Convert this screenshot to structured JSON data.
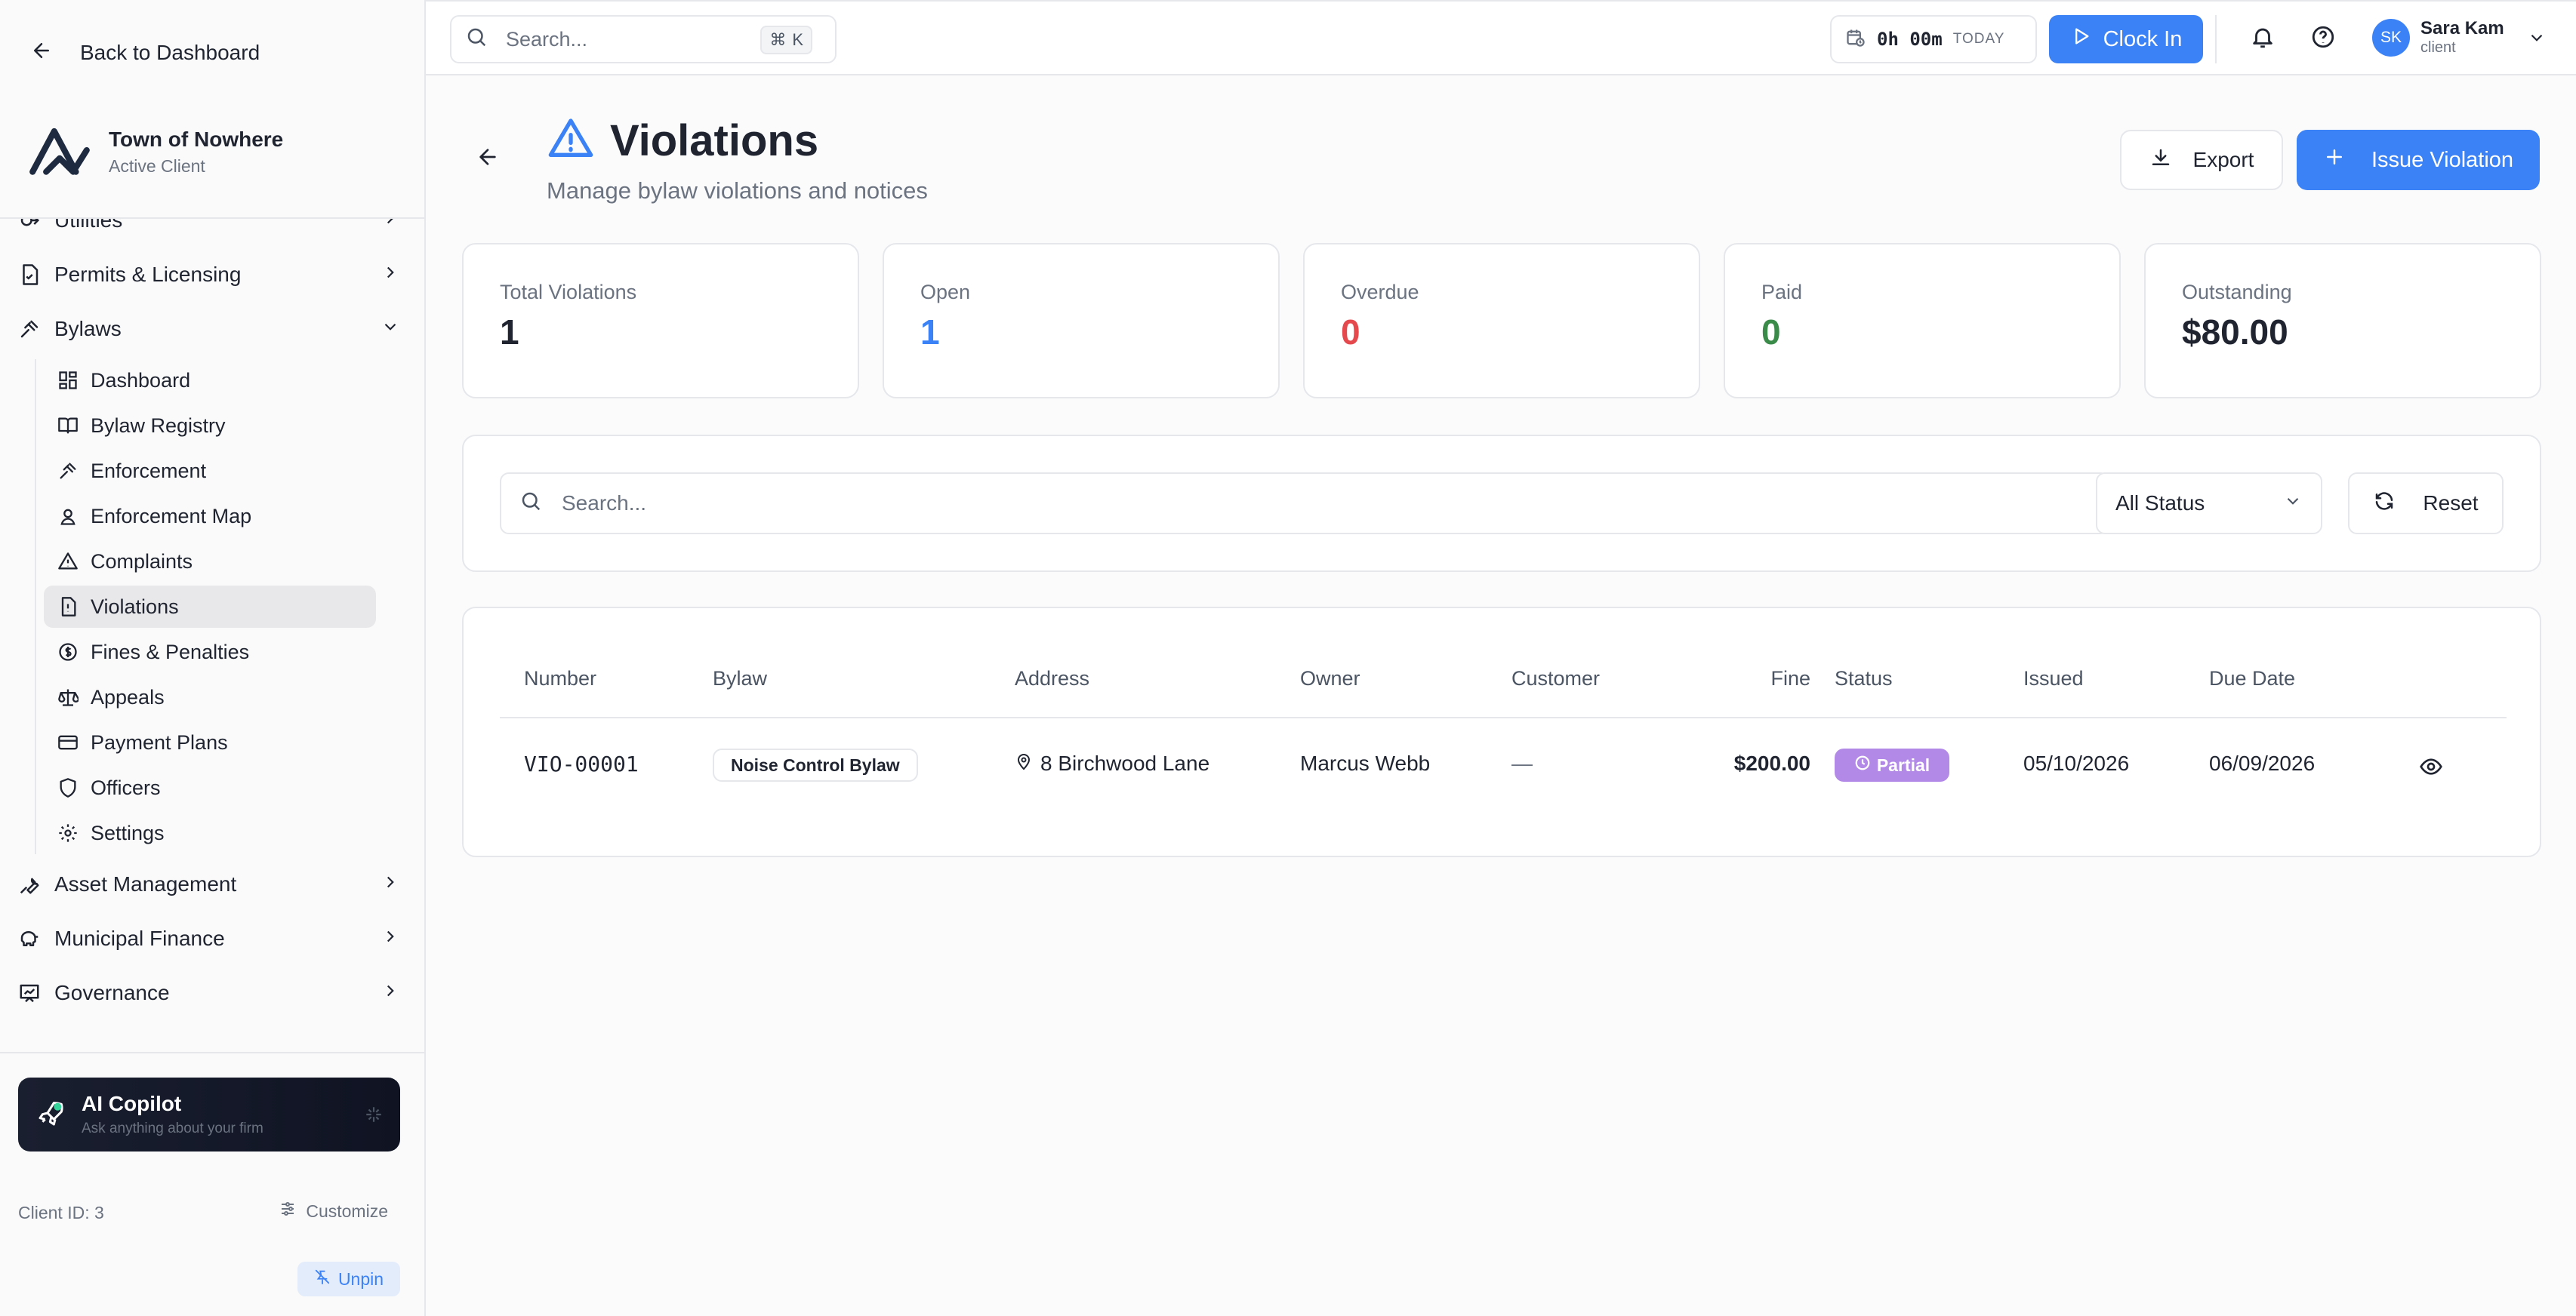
{
  "sidebar": {
    "back_label": "Back to Dashboard",
    "client_name": "Town of Nowhere",
    "client_status": "Active Client",
    "nav": [
      {
        "label": "Utilities",
        "icon": "utilities-icon"
      },
      {
        "label": "Permits & Licensing",
        "icon": "file-check-icon"
      },
      {
        "label": "Bylaws",
        "icon": "gavel-icon",
        "expanded": true
      }
    ],
    "bylaw_items": [
      {
        "label": "Dashboard",
        "icon": "dashboard-icon"
      },
      {
        "label": "Bylaw Registry",
        "icon": "book-icon"
      },
      {
        "label": "Enforcement",
        "icon": "gavel-icon"
      },
      {
        "label": "Enforcement Map",
        "icon": "map-pin-user-icon"
      },
      {
        "label": "Complaints",
        "icon": "warning-icon"
      },
      {
        "label": "Violations",
        "icon": "file-alert-icon",
        "active": true
      },
      {
        "label": "Fines & Penalties",
        "icon": "dollar-circle-icon"
      },
      {
        "label": "Appeals",
        "icon": "scale-icon"
      },
      {
        "label": "Payment Plans",
        "icon": "credit-card-icon"
      },
      {
        "label": "Officers",
        "icon": "shield-icon"
      },
      {
        "label": "Settings",
        "icon": "gear-icon"
      }
    ],
    "nav_bottom": [
      {
        "label": "Asset Management",
        "icon": "wrench-icon"
      },
      {
        "label": "Municipal Finance",
        "icon": "piggy-bank-icon"
      },
      {
        "label": "Governance",
        "icon": "chart-board-icon"
      }
    ],
    "copilot_title": "AI Copilot",
    "copilot_subtitle": "Ask anything about your firm",
    "client_id": "Client ID: 3",
    "customize_label": "Customize",
    "unpin_label": "Unpin"
  },
  "topbar": {
    "search_placeholder": "Search...",
    "shortcut_cmd": "⌘",
    "shortcut_key": "K",
    "timer_value": "0h 00m",
    "timer_label": "TODAY",
    "clock_in_label": "Clock In",
    "user_initials": "SK",
    "user_name": "Sara Kam",
    "user_role": "client"
  },
  "page": {
    "title": "Violations",
    "subtitle": "Manage bylaw violations and notices",
    "export_label": "Export",
    "issue_label": "Issue Violation"
  },
  "stats": [
    {
      "label": "Total Violations",
      "value": "1"
    },
    {
      "label": "Open",
      "value": "1"
    },
    {
      "label": "Overdue",
      "value": "0"
    },
    {
      "label": "Paid",
      "value": "0"
    },
    {
      "label": "Outstanding",
      "value": "$80.00"
    }
  ],
  "filters": {
    "search_placeholder": "Search...",
    "status_selected": "All Status",
    "reset_label": "Reset"
  },
  "table": {
    "columns": [
      "Number",
      "Bylaw",
      "Address",
      "Owner",
      "Customer",
      "Fine",
      "Status",
      "Issued",
      "Due Date"
    ],
    "rows": [
      {
        "number": "VIO-00001",
        "bylaw": "Noise Control Bylaw",
        "address": "8 Birchwood Lane",
        "owner": "Marcus Webb",
        "customer": "—",
        "fine": "$200.00",
        "status": "Partial",
        "issued": "05/10/2026",
        "due_date": "06/09/2026"
      }
    ]
  },
  "colors": {
    "accent": "#3b82f6",
    "overdue": "#e5484d",
    "paid": "#3a8a4a",
    "partial_badge": "#b389e8"
  }
}
